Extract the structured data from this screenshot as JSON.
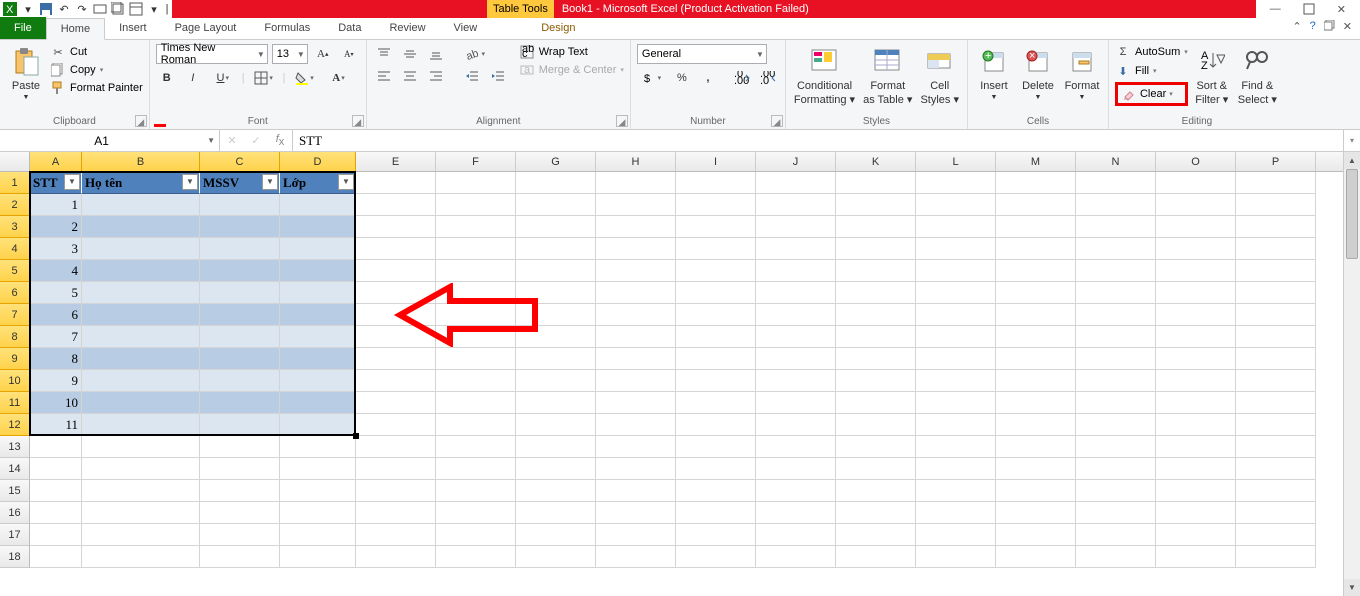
{
  "title_context_tab": "Table Tools",
  "app_title": "Book1 - Microsoft Excel (Product Activation Failed)",
  "tabs": {
    "file": "File",
    "home": "Home",
    "insert": "Insert",
    "page": "Page Layout",
    "formulas": "Formulas",
    "data": "Data",
    "review": "Review",
    "view": "View",
    "design": "Design"
  },
  "clipboard": {
    "paste": "Paste",
    "cut": "Cut",
    "copy": "Copy",
    "painter": "Format Painter",
    "label": "Clipboard"
  },
  "font": {
    "name": "Times New Roman",
    "size": "13",
    "label": "Font"
  },
  "alignment": {
    "wrap": "Wrap Text",
    "merge": "Merge & Center",
    "label": "Alignment"
  },
  "number": {
    "format": "General",
    "label": "Number"
  },
  "styles": {
    "cond": "Conditional",
    "cond2": "Formatting",
    "fmt": "Format",
    "fmt2": "as Table",
    "cell": "Cell",
    "cell2": "Styles",
    "label": "Styles"
  },
  "cells": {
    "insert": "Insert",
    "delete": "Delete",
    "format": "Format",
    "label": "Cells"
  },
  "editing": {
    "autosum": "AutoSum",
    "fill": "Fill",
    "clear": "Clear",
    "sort": "Sort &",
    "sort2": "Filter",
    "find": "Find &",
    "find2": "Select",
    "label": "Editing"
  },
  "namebox": "A1",
  "formula": "STT",
  "col_widths": {
    "A": 52,
    "B": 118,
    "C": 80,
    "D": 76,
    "other": 80
  },
  "sel_cols": [
    "A",
    "B",
    "C",
    "D"
  ],
  "columns": [
    "A",
    "B",
    "C",
    "D",
    "E",
    "F",
    "G",
    "H",
    "I",
    "J",
    "K",
    "L",
    "M",
    "N",
    "O",
    "P"
  ],
  "table": {
    "headers": [
      "STT",
      "Họ tên",
      "MSSV",
      "Lớp"
    ],
    "rows": [
      [
        "1",
        "",
        "",
        ""
      ],
      [
        "2",
        "",
        "",
        ""
      ],
      [
        "3",
        "",
        "",
        ""
      ],
      [
        "4",
        "",
        "",
        ""
      ],
      [
        "5",
        "",
        "",
        ""
      ],
      [
        "6",
        "",
        "",
        ""
      ],
      [
        "7",
        "",
        "",
        ""
      ],
      [
        "8",
        "",
        "",
        ""
      ],
      [
        "9",
        "",
        "",
        ""
      ],
      [
        "10",
        "",
        "",
        ""
      ],
      [
        "11",
        "",
        "",
        ""
      ]
    ]
  },
  "visible_row_count": 18
}
